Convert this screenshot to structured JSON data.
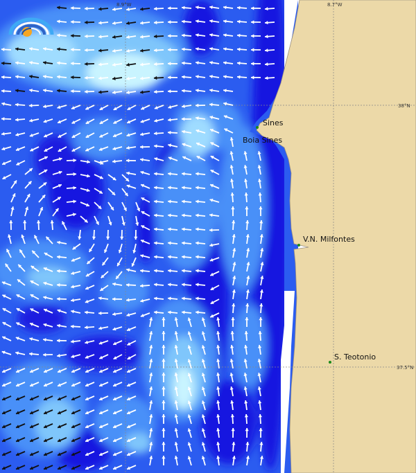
{
  "coordinates": {
    "lon_left": "8.9°W",
    "lon_right": "8.7°W",
    "lat_top": "38°N",
    "lat_bottom": "37.5°N"
  },
  "places": [
    {
      "name": "Sines"
    },
    {
      "name": "Boia Sines"
    },
    {
      "name": "V.N. Milfontes"
    },
    {
      "name": "S. Teotonio"
    }
  ],
  "colors": {
    "land": "#ecd9a8",
    "ocean_deep": "#1515e0",
    "ocean_mid": "#2b5cf0",
    "ocean_light": "#4a90f8",
    "current_pale": "#7fc6fb",
    "current_brightest": "#c9f4ff",
    "arrow_white": "#ffffff",
    "arrow_black": "#111111",
    "marker": "#1a8a1a",
    "gridline": "#888888"
  },
  "logo": {
    "icon": "rainbow-sun-icon"
  }
}
